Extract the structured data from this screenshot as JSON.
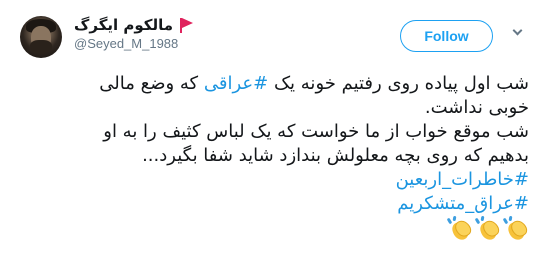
{
  "header": {
    "display_name": "مالکوم ایگرگ",
    "handle": "@Seyed_M_1988",
    "follow_label": "Follow"
  },
  "icons": {
    "flag": "flag-icon",
    "caret": "chevron-down-icon",
    "clap": "clapping-hands-icon"
  },
  "colors": {
    "accent": "#1da1f2",
    "hashtag": "#1b95e0",
    "flag": "#e0245e"
  },
  "body": {
    "line1_before": "شب اول پیاده روی رفتیم خونه یک ",
    "line1_hashtag": "#عراقی",
    "line1_after": " که وضع مالی",
    "line2": "خوبی نداشت.",
    "line3": "شب موقع خواب از ما خواست که یک لباس کثیف را به او",
    "line4": "بدهیم که روی بچه معلولش بندازد شاید شفا بگیرد...",
    "hashtag1": "#خاطرات_اربعین",
    "hashtag2": "#عراق_متشکریم",
    "clap_count": 3
  }
}
